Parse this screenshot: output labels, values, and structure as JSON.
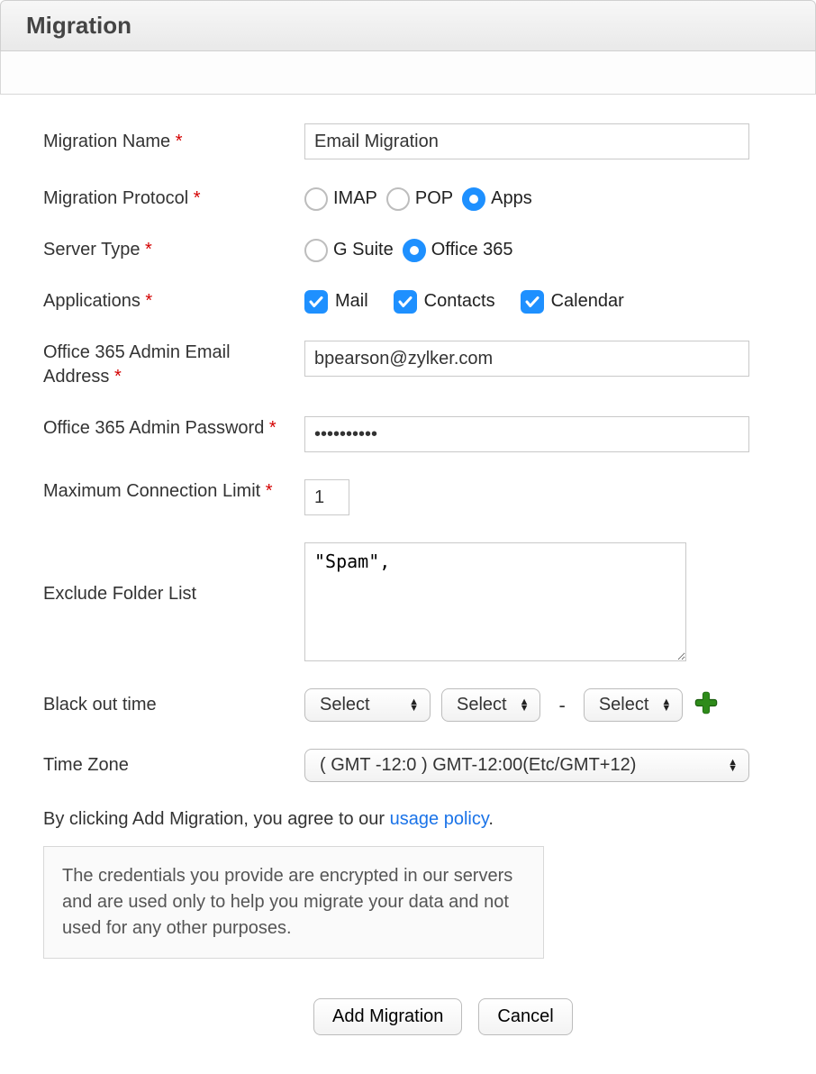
{
  "header": {
    "title": "Migration"
  },
  "labels": {
    "migration_name": "Migration Name",
    "migration_protocol": "Migration Protocol",
    "server_type": "Server Type",
    "applications": "Applications",
    "admin_email": "Office 365 Admin Email Address",
    "admin_password": "Office 365 Admin Password",
    "max_conn": "Maximum Connection Limit",
    "exclude_folders": "Exclude Folder List",
    "blackout": "Black out time",
    "timezone": "Time Zone",
    "required": "*"
  },
  "values": {
    "migration_name": "Email Migration",
    "admin_email": "bpearson@zylker.com",
    "admin_password": "••••••••••",
    "max_conn": "1",
    "exclude_folders": "\"Spam\",",
    "timezone_selected": "( GMT -12:0 ) GMT-12:00(Etc/GMT+12)"
  },
  "protocol": {
    "options": {
      "imap": "IMAP",
      "pop": "POP",
      "apps": "Apps"
    },
    "selected": "apps"
  },
  "server_type": {
    "options": {
      "gsuite": "G Suite",
      "o365": "Office 365"
    },
    "selected": "o365"
  },
  "applications": {
    "mail": {
      "label": "Mail",
      "checked": true
    },
    "contacts": {
      "label": "Contacts",
      "checked": true
    },
    "calendar": {
      "label": "Calendar",
      "checked": true
    }
  },
  "blackout": {
    "day": "Select",
    "from": "Select",
    "separator": "-",
    "to": "Select"
  },
  "agree": {
    "prefix": "By clicking Add Migration, you agree to our ",
    "link": "usage policy",
    "suffix": "."
  },
  "info_box": "The credentials you provide are encrypted in our servers and are used only to help you migrate your data and not used for any other purposes.",
  "buttons": {
    "add": "Add Migration",
    "cancel": "Cancel"
  }
}
